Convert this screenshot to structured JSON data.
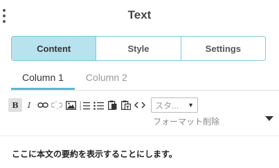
{
  "panel": {
    "title": "Text"
  },
  "segments": [
    {
      "label": "Content",
      "active": true
    },
    {
      "label": "Style",
      "active": false
    },
    {
      "label": "Settings",
      "active": false
    }
  ],
  "column_tabs": [
    {
      "label": "Column 1",
      "active": true
    },
    {
      "label": "Column 2",
      "active": false
    }
  ],
  "toolbar": {
    "bold_label": "B",
    "italic_label": "I",
    "style_select_value": "スタ...",
    "remove_format_label": "フォーマット削除"
  },
  "editor": {
    "content": "ここに本文の要約を表示することにします。"
  },
  "colors": {
    "accent": "#5fb7cf",
    "active_segment_bg": "#b7e2ee",
    "segment_border": "#7cc6dc"
  }
}
